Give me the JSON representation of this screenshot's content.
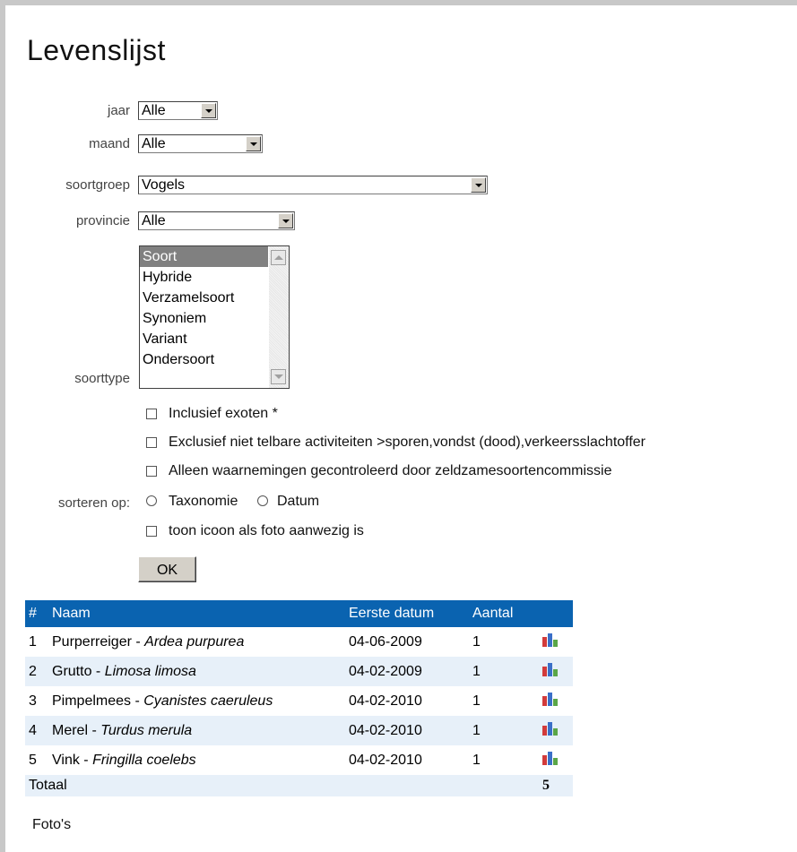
{
  "page_title": "Levenslijst",
  "filters": {
    "jaar_label": "jaar",
    "jaar_value": "Alle",
    "maand_label": "maand",
    "maand_value": "Alle",
    "soortgroep_label": "soortgroep",
    "soortgroep_value": "Vogels",
    "provincie_label": "provincie",
    "provincie_value": "Alle",
    "soorttype_label": "soorttype",
    "soorttype_options": [
      "Soort",
      "Hybride",
      "Verzamelsoort",
      "Synoniem",
      "Variant",
      "Ondersoort"
    ]
  },
  "checkboxes": {
    "exoten": "Inclusief exoten *",
    "niet_telbaar": "Exclusief niet telbare activiteiten >sporen,vondst (dood),verkeersslachtoffer",
    "zeldzaam": "Alleen waarnemingen gecontroleerd door zeldzamesoortencommissie",
    "foto_icoon": "toon icoon als foto aanwezig is"
  },
  "sort": {
    "label": "sorteren op:",
    "taxonomie": "Taxonomie",
    "datum": "Datum"
  },
  "ok_label": "OK",
  "table": {
    "headers": [
      "#",
      "Naam",
      "Eerste datum",
      "Aantal"
    ],
    "rows": [
      {
        "num": "1",
        "name": "Purperreiger - ",
        "sci": "Ardea purpurea",
        "date": "04-06-2009",
        "count": "1"
      },
      {
        "num": "2",
        "name": "Grutto - ",
        "sci": "Limosa limosa",
        "date": "04-02-2009",
        "count": "1"
      },
      {
        "num": "3",
        "name": "Pimpelmees - ",
        "sci": "Cyanistes caeruleus",
        "date": "04-02-2010",
        "count": "1"
      },
      {
        "num": "4",
        "name": "Merel - ",
        "sci": "Turdus merula",
        "date": "04-02-2010",
        "count": "1"
      },
      {
        "num": "5",
        "name": "Vink - ",
        "sci": "Fringilla coelebs",
        "date": "04-02-2010",
        "count": "1"
      }
    ],
    "total_label": "Totaal",
    "total_value": "5"
  },
  "fotos_label": "Foto's",
  "colors": {
    "header_blue": "#0a63b0",
    "row_alt": "#e7f0f9"
  }
}
